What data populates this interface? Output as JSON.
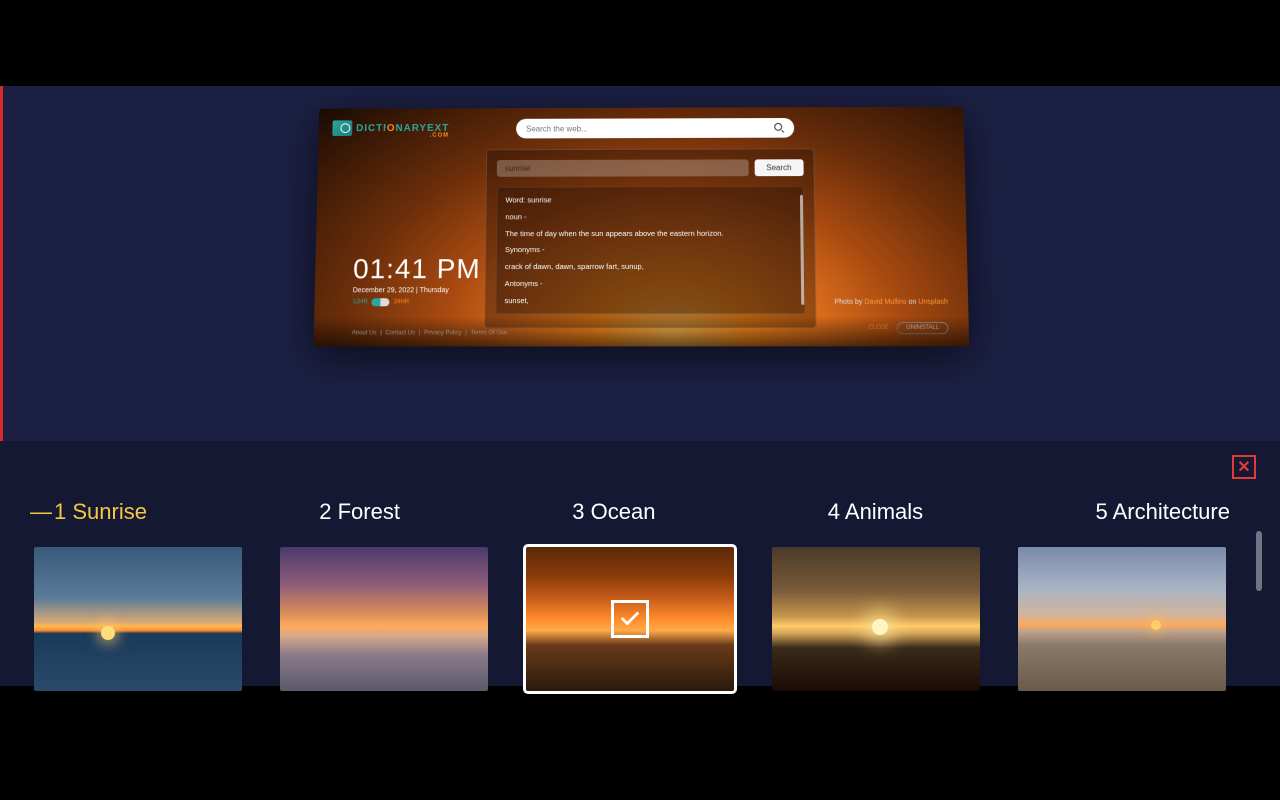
{
  "logo": {
    "brand_pre": "DICTI",
    "brand_mid": "O",
    "brand_post": "NARYEXT",
    "suffix": ".COM"
  },
  "websearch": {
    "placeholder": "Search the web..."
  },
  "dict": {
    "input_value": "sunrise",
    "search_label": "Search",
    "lines": {
      "word": "Word: sunrise",
      "pos": "noun -",
      "def": "The time of day when the sun appears above the eastern horizon.",
      "syn_label": "Synonyms -",
      "syn_list": "crack of dawn, dawn, sparrow fart, sunup,",
      "ant_label": "Antonyms -",
      "ant_list": "sunset,"
    }
  },
  "clock": {
    "time": "01:41 PM",
    "date": "December 29, 2022  |  Thursday",
    "h12": "12HR",
    "h24": "24HR"
  },
  "footer": {
    "about": "About Us",
    "contact": "Contact Us",
    "privacy": "Privacy Policy",
    "terms": "Terms Of Use",
    "sep": "|"
  },
  "credit": {
    "prefix": "Photo by ",
    "author": "David Mullins",
    "on": " on ",
    "site": "Unsplash"
  },
  "bottom_right": {
    "close": "CLOSE",
    "uninstall": "UNINSTALL"
  },
  "tabs": [
    {
      "label": "1 Sunrise",
      "active": true
    },
    {
      "label": "2 Forest",
      "active": false
    },
    {
      "label": "3 Ocean",
      "active": false
    },
    {
      "label": "4 Animals",
      "active": false
    },
    {
      "label": "5 Architecture",
      "active": false
    }
  ],
  "thumbs_selected_index": 2
}
